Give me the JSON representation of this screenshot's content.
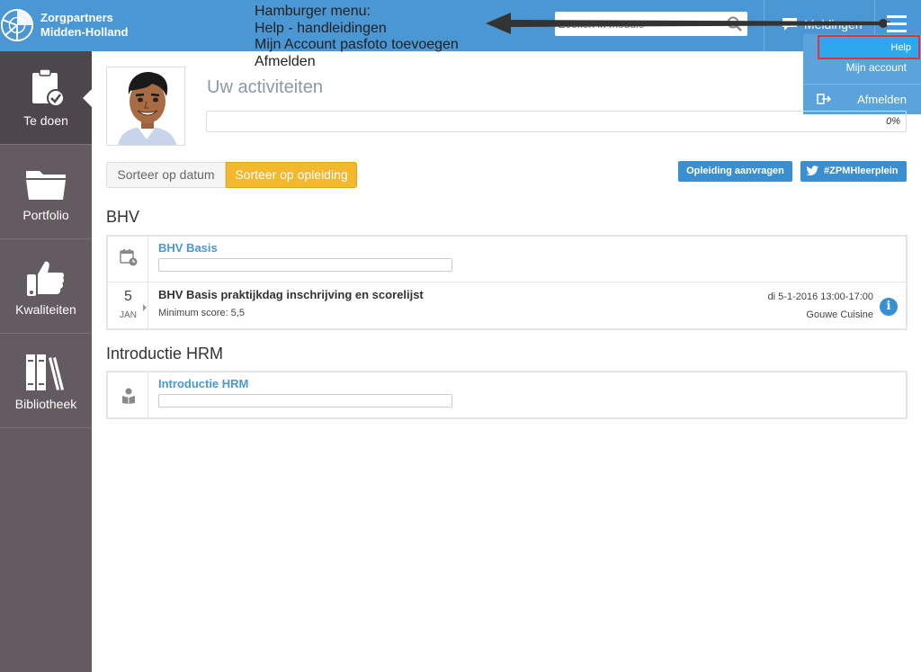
{
  "header": {
    "logo_line1": "Zorgpartners",
    "logo_line2": "Midden-Holland",
    "search_placeholder": "Zoeken in module",
    "notifications_label": "Meldingen",
    "brand_color": "#4a97d4"
  },
  "annotation": {
    "lines": [
      "Hamburger menu:",
      "Help - handleidingen",
      "Mijn Account pasfoto toevoegen",
      "Afmelden"
    ]
  },
  "dropdown": {
    "help": "Help",
    "account": "Mijn account",
    "logout": "Afmelden"
  },
  "sidebar": {
    "items": [
      {
        "label": "Te doen",
        "icon": "clipboard-check-icon",
        "active": true
      },
      {
        "label": "Portfolio",
        "icon": "folder-icon"
      },
      {
        "label": "Kwaliteiten",
        "icon": "thumbs-up-icon"
      },
      {
        "label": "Bibliotheek",
        "icon": "books-icon"
      }
    ]
  },
  "main": {
    "title": "Uw activiteiten",
    "progress_text": "0%",
    "progress_value": 0,
    "sort_date": "Sorteer op datum",
    "sort_training": "Sorteer op opleiding",
    "request_button": "Opleiding aanvragen",
    "twitter_button": "#ZPMHleerplein",
    "accent_color": "#f3b82b",
    "sections": [
      {
        "title": "BHV",
        "course": "BHV Basis",
        "event": {
          "day": "5",
          "month": "JAN",
          "title": "BHV Basis praktijkdag inschrijving en scorelijst",
          "subtitle": "Minimum score: 5,5",
          "date": "di 5-1-2016 13:00-17:00",
          "location": "Gouwe Cuisine"
        }
      },
      {
        "title": "Introductie HRM",
        "course": "Introductie HRM"
      }
    ]
  }
}
